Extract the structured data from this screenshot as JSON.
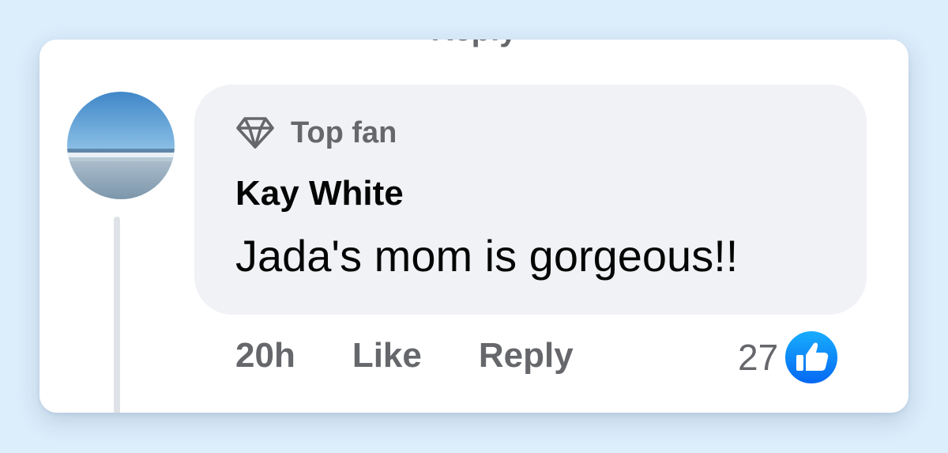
{
  "previous_comment": {
    "cut_off_text": "Reply"
  },
  "comment": {
    "avatar": {
      "icon": "avatar-beach-photo",
      "colors": {
        "sky": "#4a8fcb",
        "sea": "#b7ccd9",
        "sand": "#8aa4b8"
      }
    },
    "badge": {
      "icon": "diamond-icon",
      "label": "Top fan"
    },
    "author": "Kay White",
    "text": "Jada's mom is gorgeous!!",
    "actions": {
      "timestamp": "20h",
      "like_label": "Like",
      "reply_label": "Reply"
    },
    "reactions": {
      "count": "27",
      "icon": "like-reaction-icon",
      "color": "#1877f2"
    }
  }
}
